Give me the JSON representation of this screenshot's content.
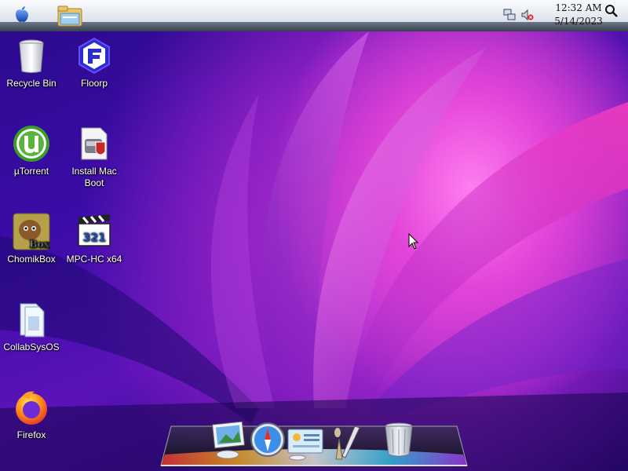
{
  "menubar": {
    "apple_menu": "apple-logo-icon",
    "file_manager": "folder-icon",
    "clock": {
      "time": "12:32 AM",
      "date": "5/14/2023"
    },
    "tray": [
      "network-icon",
      "volume-muted-icon"
    ],
    "search": "search-icon"
  },
  "desktop": {
    "icons": [
      {
        "id": "recycle-bin",
        "label": "Recycle Bin"
      },
      {
        "id": "floorp",
        "label": "Floorp"
      },
      {
        "id": "utorrent",
        "label": "µTorrent"
      },
      {
        "id": "install-mac-boot",
        "label": "Install Mac Boot"
      },
      {
        "id": "chomikbox",
        "label": "ChomikBox"
      },
      {
        "id": "mpc-hc",
        "label": "MPC-HC x64"
      },
      {
        "id": "collabsysos",
        "label": "CollabSysOS"
      },
      {
        "id": "firefox",
        "label": "Firefox"
      }
    ],
    "chomikbox_badge": "Box",
    "mpc_badge": "321"
  },
  "dock": {
    "items": [
      "preview-icon",
      "safari-icon",
      "system-info-icon",
      "pencil-icon",
      "trash-icon"
    ]
  },
  "colors": {
    "wallpaper_dark": "#2a0a8a",
    "wallpaper_mid": "#8a1fc2",
    "wallpaper_bright": "#ff7ef0",
    "menubar": "#e4e8ef"
  }
}
